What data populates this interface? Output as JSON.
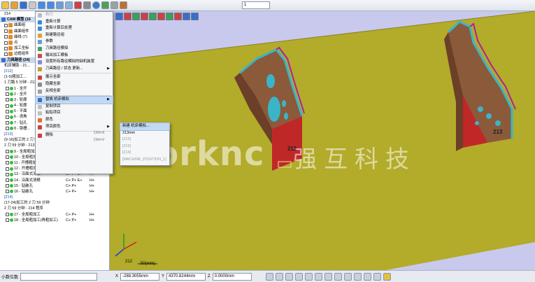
{
  "toolbar": {
    "combo_value": "1",
    "icons": [
      "new-icon",
      "open-icon",
      "save-icon",
      "print-icon",
      "undo-icon",
      "redo-icon",
      "grid-icon",
      "layout-icon",
      "machine-icon",
      "tool-icon",
      "sphere-icon",
      "cube-icon",
      "settings-icon",
      "layers-icon"
    ]
  },
  "tree": {
    "rows": [
      {
        "type": "plain",
        "text": "214"
      },
      {
        "type": "header",
        "text": "CAM 模型 (16"
      },
      {
        "type": "check",
        "text": "曲面组"
      },
      {
        "type": "check",
        "text": "曲面组件"
      },
      {
        "type": "check",
        "text": "曲线 (7)"
      },
      {
        "type": "check",
        "text": "点"
      },
      {
        "type": "check",
        "text": "加工坐标"
      },
      {
        "type": "check",
        "text": "边框组件"
      },
      {
        "type": "header",
        "text": "刀具路径 (24)"
      },
      {
        "type": "plain",
        "text": "机床辅助 - 21..."
      },
      {
        "type": "blue",
        "text": "[212]"
      },
      {
        "type": "plain",
        "text": "(1-5)粗加工..."
      },
      {
        "type": "plain",
        "text": "1 刀路 5 分钟 - 212"
      },
      {
        "type": "op",
        "text": "1 - 全开"
      },
      {
        "type": "op",
        "text": "2 - 全开"
      },
      {
        "type": "op",
        "text": "3 - 轮廓"
      },
      {
        "type": "op",
        "text": "4 - 轮廓"
      },
      {
        "type": "op",
        "text": "5 - 平面"
      },
      {
        "type": "op",
        "text": "6 - 清角"
      },
      {
        "type": "op",
        "text": "7 - 钻孔"
      },
      {
        "type": "op",
        "text": "8 - 锁槽..."
      },
      {
        "type": "blue",
        "text": "[213]"
      },
      {
        "type": "plain",
        "text": "(9-16)加工的 2 刀 59 分钟"
      },
      {
        "type": "plain",
        "text": "2 刀 59 分钟 - 213 程序"
      },
      {
        "type": "op",
        "text": "9 - 全局粗加工",
        "c2": "C+  P+",
        "c3": "S+  H+"
      },
      {
        "type": "op",
        "text": "10 - 全局粗加工(再粗加工)",
        "c2": "C+  P+",
        "c3": "H+"
      },
      {
        "type": "op",
        "text": "11 - 开槽粗加工",
        "c2": "C+  P+",
        "c3": "H+"
      },
      {
        "type": "op",
        "text": "12 - 开槽粗加工",
        "c2": "C+  P+",
        "c3": "H+"
      },
      {
        "type": "op",
        "text": "13 - 沿面式清根",
        "c2": "C+  P+  E+",
        "c3": "H+"
      },
      {
        "type": "op",
        "text": "14 - 沿面式清根",
        "c2": "C+  P+  E+",
        "c3": "H+"
      },
      {
        "type": "op",
        "text": "15 - 钻破孔",
        "c2": "C+  P+",
        "c3": "H+"
      },
      {
        "type": "op",
        "text": "16 - 钻破孔",
        "c2": "C+  P+",
        "c3": "H+"
      },
      {
        "type": "blue",
        "text": "[214]"
      },
      {
        "type": "plain",
        "text": "(17-24)加工的 2 刀 59 分钟"
      },
      {
        "type": "plain",
        "text": "2 刀 59 分钟 - 214 程序"
      },
      {
        "type": "op",
        "text": "17 - 全局粗加工",
        "c2": "C+  P+",
        "c3": "H+"
      },
      {
        "type": "op",
        "text": "18 - 全局粗加工(再粗加工)",
        "c2": "C+  P+",
        "c3": "H+"
      }
    ]
  },
  "context_menu": {
    "items": [
      {
        "label": "执行",
        "disabled": true
      },
      {
        "label": "重新计算"
      },
      {
        "label": "重新计算后处理"
      },
      {
        "label": "新建路径组"
      },
      {
        "label": "参数"
      },
      {
        "label": "刀具路径模拟"
      },
      {
        "label": "输出加工模板"
      },
      {
        "label": "设置所有路径模拟的缺机装置"
      },
      {
        "label": "刀具路径 / 状态 更新...",
        "arrow": true
      },
      {
        "sep": true
      },
      {
        "label": "展示全部"
      },
      {
        "label": "隐藏全部"
      },
      {
        "label": "反相全部"
      },
      {
        "sep": true
      },
      {
        "label": "替换 机床模拟",
        "arrow": true,
        "highlight": true
      },
      {
        "label": "复制项目"
      },
      {
        "label": "粘贴项目"
      },
      {
        "label": "颜色"
      },
      {
        "label": "项目颜色",
        "arrow": true
      },
      {
        "sep": true
      },
      {
        "label": "删除"
      }
    ],
    "shortcut_copy": "Ctrl+X",
    "shortcut_paste": "Ctrl+V"
  },
  "submenu": {
    "items": [
      {
        "label": "新建 机床模拟...",
        "highlight": true
      },
      {
        "label": "213mm"
      },
      {
        "label": "[212]",
        "disabled": true
      },
      {
        "label": "[213]",
        "disabled": true
      },
      {
        "label": "[214]",
        "disabled": true
      },
      {
        "label": "[MACHINE_POSITION_1]",
        "disabled": true
      }
    ]
  },
  "viewport": {
    "watermark": "vorknc",
    "watermark_cn": "强互科技",
    "part_labels": [
      "212",
      "213"
    ],
    "axis_label": "212",
    "scale_label": "50(mm)"
  },
  "statusbar": {
    "field_label": "小数位数",
    "x_label": "X",
    "x_value": "-288.3055mm",
    "y_label": "Y",
    "y_value": "4370.8244mm",
    "z_label": "Z",
    "z_value": "0.0000mm"
  },
  "colors": {
    "viewport_bg": "#c9c9ee",
    "plane": "#b3ab2a",
    "part_body": "#8a5a3a",
    "part_edge": "#3ab5c8",
    "part_accent": "#b01e9e",
    "part_shadow": "#c02828"
  }
}
